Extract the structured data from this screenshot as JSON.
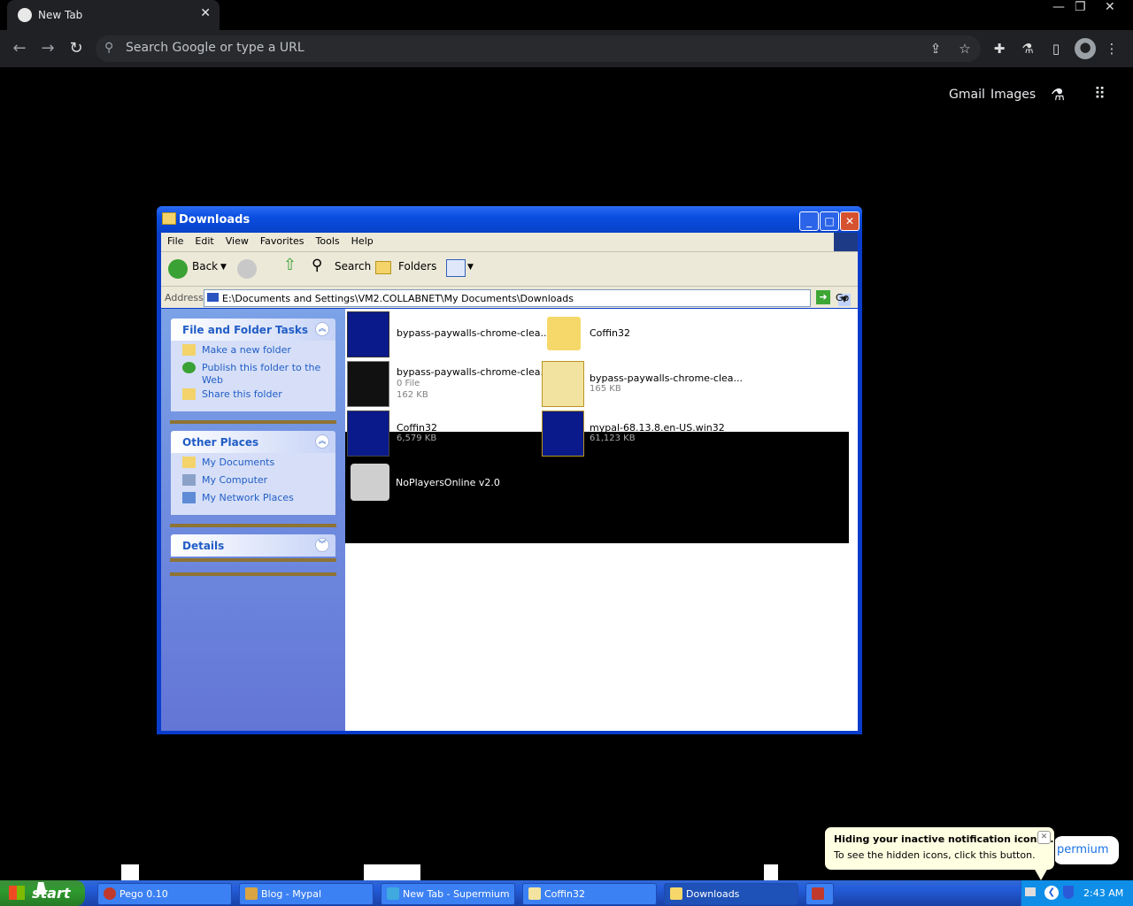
{
  "browser": {
    "tab_title": "New Tab",
    "omnibox_placeholder": "Search Google or type a URL",
    "ntp_links": [
      "Gmail",
      "Images"
    ]
  },
  "window": {
    "title": "Downloads",
    "menu": [
      "File",
      "Edit",
      "View",
      "Favorites",
      "Tools",
      "Help"
    ],
    "toolbar": {
      "back": "Back",
      "search": "Search",
      "folders": "Folders"
    },
    "address": {
      "label": "Address",
      "value": "E:\\Documents and Settings\\VM2.COLLABNET\\My Documents\\Downloads",
      "go": "Go"
    },
    "tasks": {
      "file_folder": {
        "title": "File and Folder Tasks",
        "items": [
          "Make a new folder",
          "Publish this folder to the Web",
          "Share this folder"
        ]
      },
      "other_places": {
        "title": "Other Places",
        "items": [
          "My Documents",
          "My Computer",
          "My Network Places"
        ]
      },
      "details": {
        "title": "Details"
      }
    },
    "files": [
      {
        "name": "bypass-paywalls-chrome-clea...",
        "sub1": "",
        "sub2": ""
      },
      {
        "name": "Coffin32",
        "sub1": "",
        "sub2": ""
      },
      {
        "name": "bypass-paywalls-chrome-clea...",
        "sub1": "0 File",
        "sub2": "162 KB"
      },
      {
        "name": "bypass-paywalls-chrome-clea...",
        "sub1": "165 KB",
        "sub2": ""
      },
      {
        "name": "Coffin32",
        "sub1": "6,579 KB",
        "sub2": ""
      },
      {
        "name": "mypal-68.13.8.en-US.win32",
        "sub1": "61,123 KB",
        "sub2": ""
      },
      {
        "name": "NoPlayersOnline v2.0",
        "sub1": "",
        "sub2": ""
      }
    ]
  },
  "taskbar": {
    "start": "start",
    "tasks": [
      "Pego 0.10",
      "Blog - Mypal",
      "New Tab - Supermium",
      "Coffin32",
      "Downloads"
    ],
    "clock": "2:43 AM"
  },
  "balloon": {
    "title": "Hiding your inactive notification icons...",
    "body": "To see the hidden icons, click this button."
  },
  "supermium_tip": "permium"
}
